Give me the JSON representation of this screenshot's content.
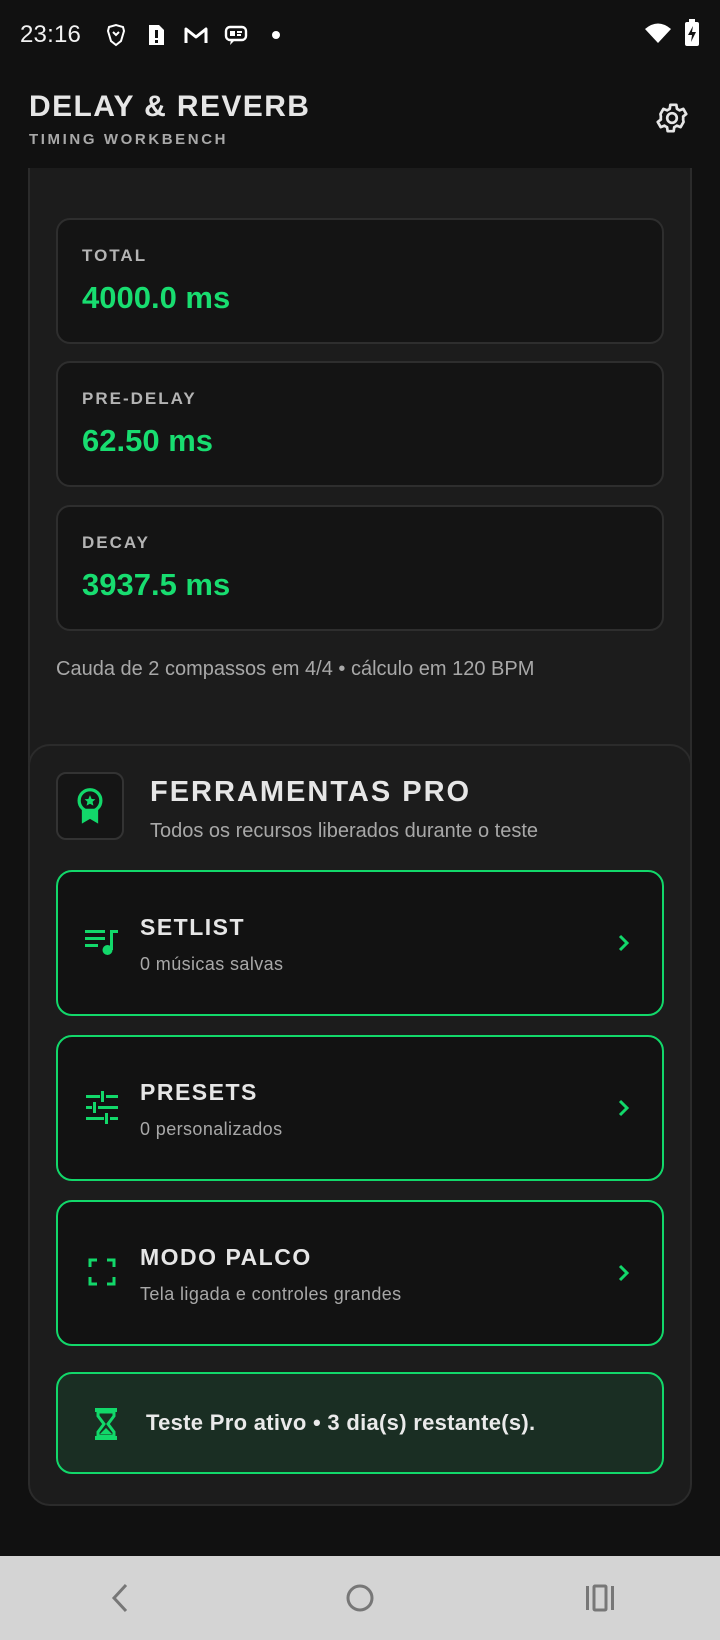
{
  "status_bar": {
    "time": "23:16",
    "notification_icons": [
      "brave-icon",
      "sim-alert-icon",
      "gmail-icon",
      "message-icon",
      "dot-icon"
    ],
    "system_icons": [
      "wifi-icon",
      "battery-charging-icon"
    ]
  },
  "app_bar": {
    "title": "DELAY & REVERB",
    "subtitle": "TIMING WORKBENCH",
    "settings_icon": "gear-icon"
  },
  "reverb_card": {
    "segments_active_index": 2,
    "metrics": [
      {
        "label": "TOTAL",
        "value": "4000.0 ms"
      },
      {
        "label": "PRE-DELAY",
        "value": "62.50 ms"
      },
      {
        "label": "DECAY",
        "value": "3937.5 ms"
      }
    ],
    "note": "Cauda de 2 compassos em 4/4 • cálculo em 120 BPM"
  },
  "pro_card": {
    "icon": "award-badge-icon",
    "title": "FERRAMENTAS PRO",
    "subtitle": "Todos os recursos liberados durante o teste",
    "tools": [
      {
        "title": "SETLIST",
        "subtitle": "0 músicas salvas",
        "icon": "playlist-music-icon"
      },
      {
        "title": "PRESETS",
        "subtitle": "0 personalizados",
        "icon": "tune-sliders-icon"
      },
      {
        "title": "MODO PALCO",
        "subtitle": "Tela ligada e controles grandes",
        "icon": "fullscreen-icon"
      }
    ],
    "trial": {
      "icon": "hourglass-icon",
      "text": "Teste Pro ativo • 3 dia(s) restante(s)."
    }
  },
  "colors": {
    "accent": "#12D86A",
    "background": "#111111",
    "card": "#1C1C1C"
  },
  "nav_bar": {
    "buttons": [
      "back-icon",
      "home-icon",
      "recents-icon"
    ]
  }
}
